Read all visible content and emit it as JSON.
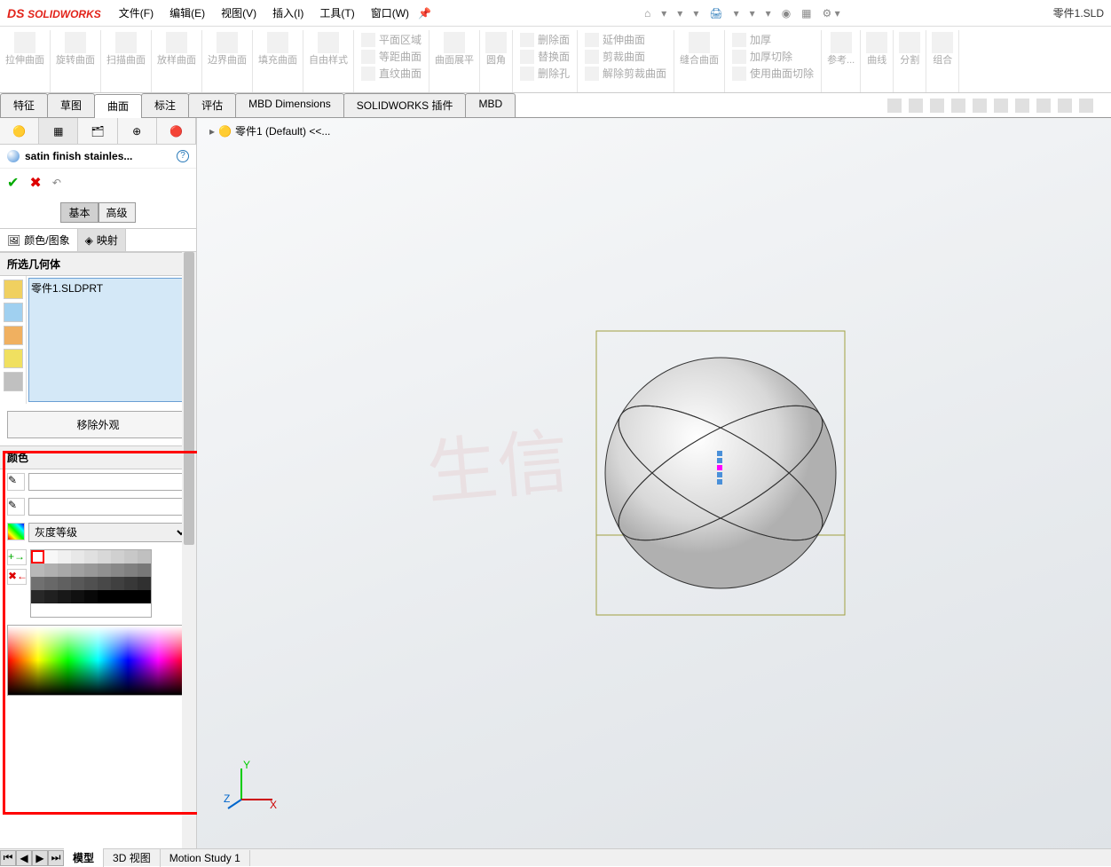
{
  "app": {
    "logo_prefix": "DS",
    "logo_name": "SOLIDWORKS",
    "doc": "零件1.SLD"
  },
  "menu": {
    "file": "文件(F)",
    "edit": "编辑(E)",
    "view": "视图(V)",
    "insert": "插入(I)",
    "tools": "工具(T)",
    "window": "窗口(W)"
  },
  "ribbon": {
    "g1": "拉伸曲面",
    "g2": "旋转曲面",
    "g3": "扫描曲面",
    "g4": "放样曲面",
    "g5": "边界曲面",
    "g6": "填充曲面",
    "g7": "自由样式",
    "s1": "平面区域",
    "s2": "等距曲面",
    "s3": "直纹曲面",
    "s4": "曲面展平",
    "s5": "圆角",
    "s6": "删除面",
    "s7": "替换面",
    "s8": "删除孔",
    "s9": "延伸曲面",
    "s10": "剪裁曲面",
    "s11": "解除剪裁曲面",
    "s12": "缝合曲面",
    "s13": "加厚",
    "s14": "加厚切除",
    "s15": "使用曲面切除",
    "s16": "参考...",
    "s17": "曲线",
    "s18": "分割",
    "s19": "组合"
  },
  "tabs": {
    "t1": "特征",
    "t2": "草图",
    "t3": "曲面",
    "t4": "标注",
    "t5": "评估",
    "t6": "MBD Dimensions",
    "t7": "SOLIDWORKS 插件",
    "t8": "MBD"
  },
  "panel": {
    "title": "satin finish stainles...",
    "mode_basic": "基本",
    "mode_adv": "高级",
    "sub1": "颜色/图象",
    "sub2": "映射",
    "sec_geom": "所选几何体",
    "geom_item": "零件1.SLDPRT",
    "btn_remove": "移除外观",
    "sec_color": "颜色",
    "color_scheme": "灰度等级"
  },
  "crumb": {
    "part": "零件1 (Default) <<..."
  },
  "bottom": {
    "t1": "模型",
    "t2": "3D 视图",
    "t3": "Motion Study 1"
  },
  "watermark": "生信"
}
